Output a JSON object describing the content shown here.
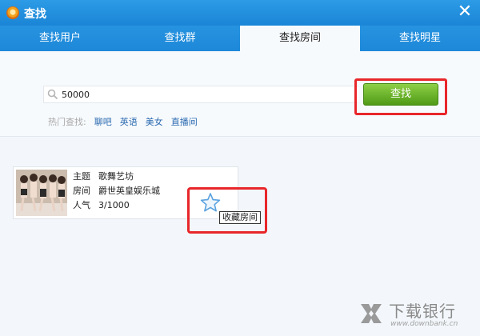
{
  "window": {
    "title": "查找",
    "close_symbol": "✕"
  },
  "tabs": [
    {
      "label": "查找用户"
    },
    {
      "label": "查找群"
    },
    {
      "label": "查找房间",
      "active": true
    },
    {
      "label": "查找明星"
    }
  ],
  "search": {
    "value": "50000",
    "button_label": "查找"
  },
  "hot": {
    "label": "热门查找:",
    "links": [
      "聊吧",
      "英语",
      "美女",
      "直播间"
    ]
  },
  "result": {
    "topic_label": "主题",
    "topic": "歌舞艺坊",
    "room_label": "房间",
    "room": "爵世英皇娱乐城",
    "popularity_label": "人气",
    "popularity": "3/1000"
  },
  "favorite": {
    "tooltip": "收藏房间"
  },
  "watermark": {
    "brand": "下载银行",
    "url": "www.downbank.cn"
  },
  "colors": {
    "title_bar": "#1a85d6",
    "search_button": "#4f9a17",
    "highlight": "#e8262a",
    "link": "#2a6ab0"
  },
  "icons": {
    "logo": "app-logo-icon",
    "close": "close-icon",
    "search": "search-icon",
    "favorite": "star-icon"
  }
}
